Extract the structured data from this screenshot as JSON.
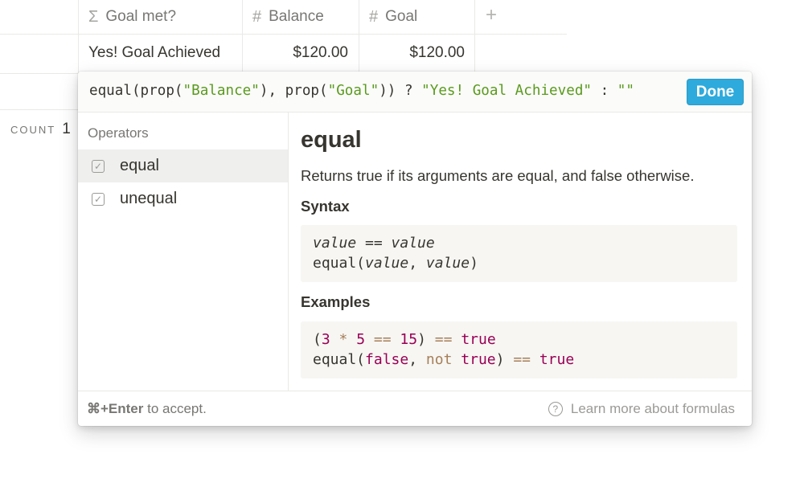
{
  "table": {
    "columns": [
      {
        "icon": "sigma-icon",
        "glyph": "Σ",
        "label": "Goal met?"
      },
      {
        "icon": "hash-icon",
        "glyph": "#",
        "label": "Balance"
      },
      {
        "icon": "hash-icon",
        "glyph": "#",
        "label": "Goal"
      }
    ],
    "add_column_glyph": "+",
    "row": {
      "goal_met": "Yes! Goal Achieved",
      "balance": "$120.00",
      "goal": "$120.00"
    },
    "footer": {
      "count_label": "COUNT",
      "count_value": "1"
    }
  },
  "formula_editor": {
    "formula": {
      "p1": "equal(prop(",
      "s1": "\"Balance\"",
      "p2": "), prop(",
      "s2": "\"Goal\"",
      "p3": ")) ? ",
      "s3": "\"Yes! Goal Achieved\"",
      "p4": " : ",
      "s4": "\"\""
    },
    "done_label": "Done",
    "section_label": "Operators",
    "operators": [
      {
        "label": "equal",
        "selected": true
      },
      {
        "label": "unequal",
        "selected": false
      }
    ],
    "doc": {
      "title": "equal",
      "description": "Returns true if its arguments are equal, and false otherwise.",
      "syntax_heading": "Syntax",
      "syntax": {
        "l1_a": "value",
        "l1_b": " == ",
        "l1_c": "value",
        "l2_a": "equal(",
        "l2_b": "value",
        "l2_c": ", ",
        "l2_d": "value",
        "l2_e": ")"
      },
      "examples_heading": "Examples",
      "examples": {
        "l1_a": "(",
        "l1_b": "3",
        "l1_c": " * ",
        "l1_d": "5",
        "l1_e": " == ",
        "l1_f": "15",
        "l1_g": ") ",
        "l1_h": "==",
        "l1_i": " ",
        "l1_j": "true",
        "l2_a": "equal(",
        "l2_b": "false",
        "l2_c": ", ",
        "l2_d": "not",
        "l2_e": " ",
        "l2_f": "true",
        "l2_g": ") ",
        "l2_h": "==",
        "l2_i": " ",
        "l2_j": "true"
      }
    },
    "footer": {
      "shortcut": "⌘+Enter",
      "shortcut_suffix": " to accept.",
      "learn_more": "Learn more about formulas",
      "help_glyph": "?"
    }
  }
}
